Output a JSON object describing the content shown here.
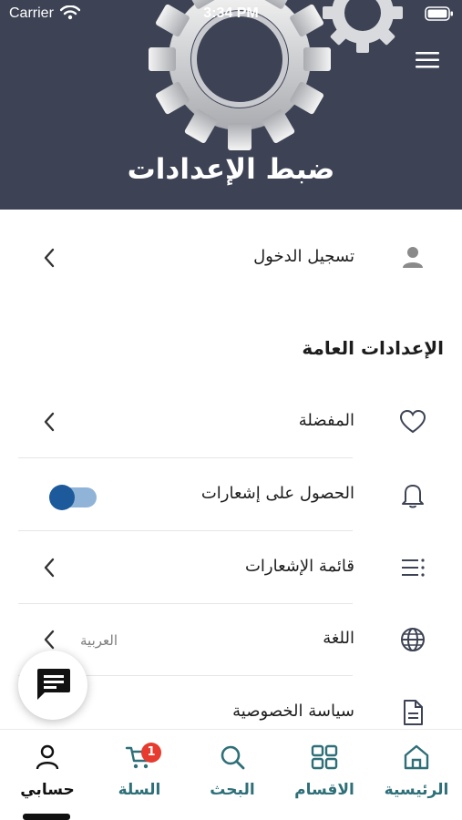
{
  "statusbar": {
    "carrier": "Carrier",
    "time": "3:34 PM"
  },
  "header": {
    "title": "ضبط الإعدادات",
    "background_color": "#3d4354",
    "menu_icon": "hamburger-menu-icon"
  },
  "login": {
    "label": "تسجيل الدخول",
    "icon": "user-icon"
  },
  "general_settings": {
    "title": "الإعدادات العامة",
    "items": [
      {
        "label": "المفضلة",
        "icon": "heart-icon"
      },
      {
        "label": "الحصول على إشعارات",
        "icon": "bell-icon",
        "toggle_on": true
      },
      {
        "label": "قائمة الإشعارات",
        "icon": "list-icon"
      },
      {
        "label": "اللغة",
        "icon": "globe-icon",
        "value": "العربية"
      },
      {
        "label": "سياسة الخصوصية",
        "icon": "document-icon"
      }
    ]
  },
  "chat": {
    "icon": "chat-bubble-icon"
  },
  "tabbar": {
    "tabs": [
      {
        "label": "الرئيسية",
        "icon": "home-icon"
      },
      {
        "label": "الاقسام",
        "icon": "grid-icon"
      },
      {
        "label": "البحث",
        "icon": "search-icon"
      },
      {
        "label": "السلة",
        "icon": "cart-icon",
        "badge": "1"
      },
      {
        "label": "حسابي",
        "icon": "account-icon",
        "active": true
      }
    ],
    "accent_color": "#2e6f78",
    "badge_color": "#e63b2e"
  }
}
